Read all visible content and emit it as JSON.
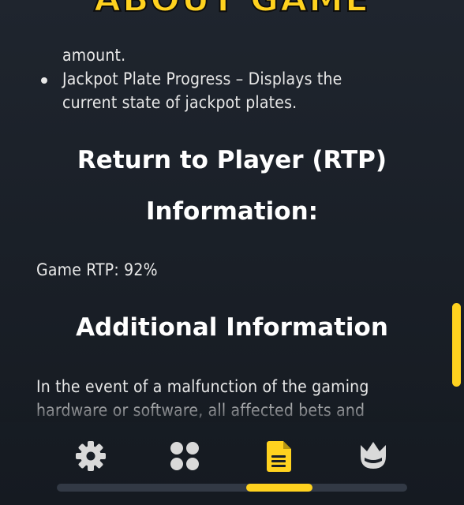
{
  "header": {
    "title": "ABOUT GAME"
  },
  "content": {
    "partial_line": "amount.",
    "bullet_text": "Jackpot Plate Progress – Displays the current state of jackpot plates.",
    "rtp_heading_line1": "Return to Player (RTP)",
    "rtp_heading_line2": "Information:",
    "rtp_value": "Game RTP: 92%",
    "additional_heading": "Additional Information",
    "paragraph": "In the event of a malfunction of the gaming hardware or software, all affected bets and"
  },
  "scrollbar": {
    "position_fraction": 0.85
  },
  "navbar": {
    "items": [
      {
        "icon": "gear-icon",
        "active": false
      },
      {
        "icon": "grid-icon",
        "active": false
      },
      {
        "icon": "document-icon",
        "active": true
      },
      {
        "icon": "crown-icon",
        "active": false
      }
    ]
  },
  "colors": {
    "accent": "#ffd21f",
    "background": "#1b2028",
    "text": "#e8e8e8",
    "icon": "#d9d9d9"
  }
}
